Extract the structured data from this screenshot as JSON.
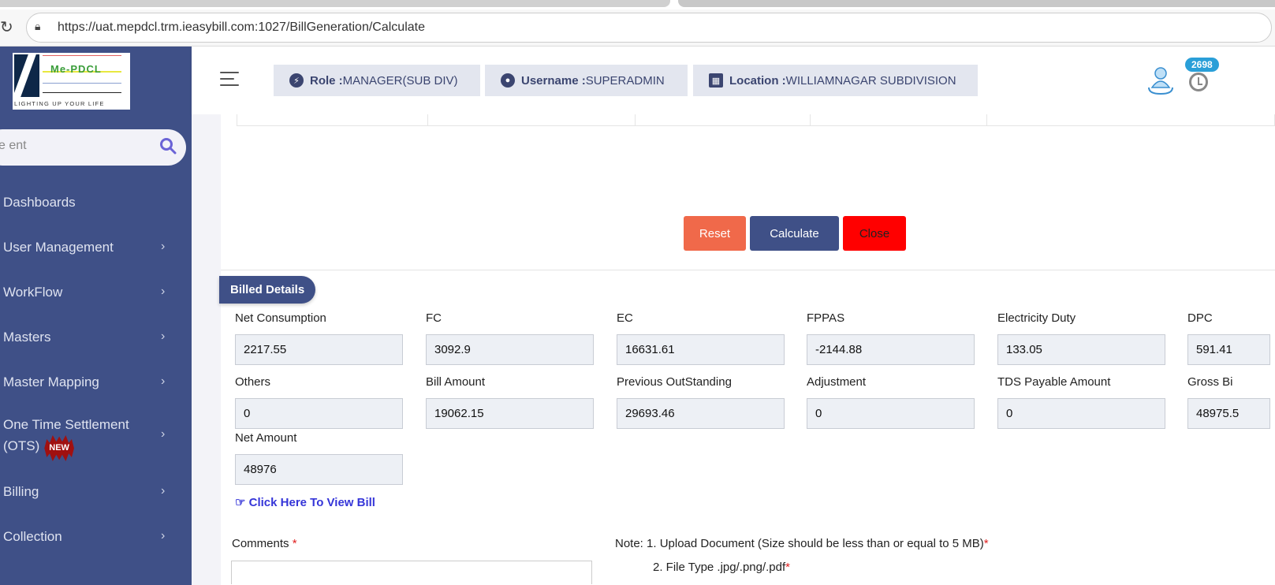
{
  "browser": {
    "url": "https://uat.mepdcl.trm.ieasybill.com:1027/BillGeneration/Calculate"
  },
  "logo": {
    "brand": "Me-PDCL",
    "tagline": "LIGHTING UP YOUR LIFE"
  },
  "sidebar": {
    "search_value": "e ent",
    "items": [
      {
        "label": "Dashboards"
      },
      {
        "label": "User Management"
      },
      {
        "label": "WorkFlow"
      },
      {
        "label": "Masters"
      },
      {
        "label": "Master Mapping"
      },
      {
        "label": "One Time Settlement (OTS)",
        "badge": "NEW"
      },
      {
        "label": "Billing"
      },
      {
        "label": "Collection"
      }
    ]
  },
  "header": {
    "role_label": "Role :",
    "role_value": "MANAGER(SUB DIV)",
    "username_label": "Username :",
    "username_value": "SUPERADMIN",
    "location_label": "Location :",
    "location_value": "WILLIAMNAGAR SUBDIVISION",
    "notification_count": "2698"
  },
  "actions": {
    "reset": "Reset",
    "calculate": "Calculate",
    "close": "Close",
    "colors": {
      "reset": "#f0694a",
      "calculate": "#3f5087",
      "close": "#ff0000"
    }
  },
  "billed": {
    "title": "Billed Details",
    "fields": [
      {
        "label": "Net Consumption",
        "value": "2217.55"
      },
      {
        "label": "FC",
        "value": "3092.9"
      },
      {
        "label": "EC",
        "value": "16631.61"
      },
      {
        "label": "FPPAS",
        "value": "-2144.88"
      },
      {
        "label": "Electricity Duty",
        "value": "133.05"
      },
      {
        "label": "DPC",
        "value": "591.41"
      },
      {
        "label": "Others",
        "value": "0"
      },
      {
        "label": "Bill Amount",
        "value": "19062.15"
      },
      {
        "label": "Previous OutStanding",
        "value": "29693.46"
      },
      {
        "label": "Adjustment",
        "value": "0"
      },
      {
        "label": "TDS Payable Amount",
        "value": "0"
      },
      {
        "label": "Gross Bi",
        "value": "48975.5"
      },
      {
        "label": "Net Amount",
        "value": "48976"
      }
    ],
    "view_bill": "Click Here To View Bill"
  },
  "form": {
    "comments_label": "Comments",
    "required_mark": "*",
    "note1": "Note: 1. Upload Document (Size should be less than or equal to 5 MB)",
    "note2": "2. File Type .jpg/.png/.pdf"
  }
}
